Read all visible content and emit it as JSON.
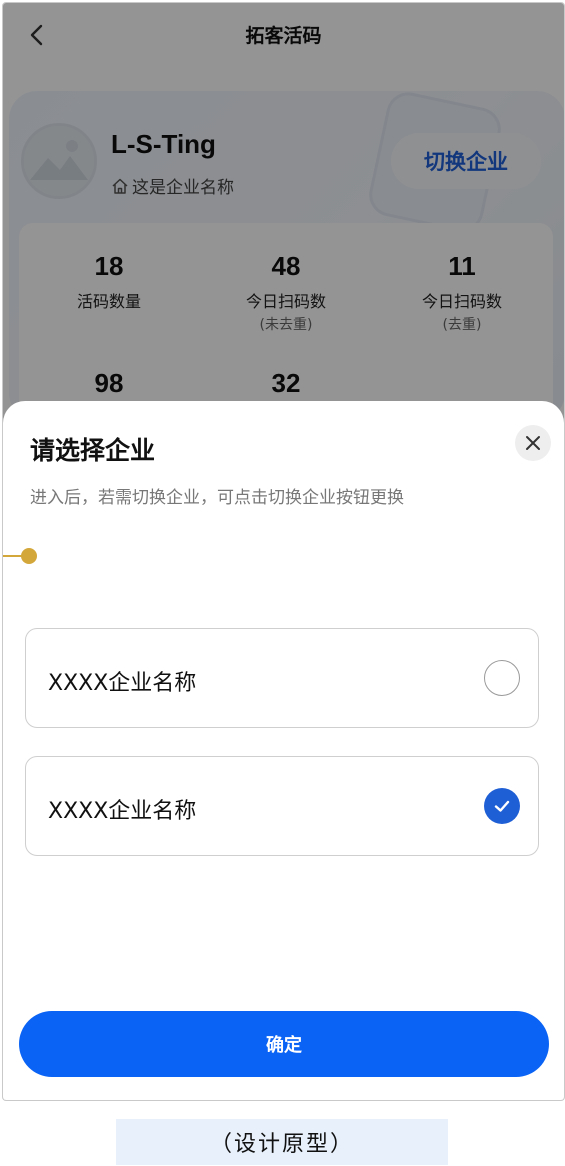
{
  "navbar": {
    "title": "拓客活码",
    "back_icon": "chevron-left-icon"
  },
  "profile": {
    "username": "L-S-Ting",
    "company_name": "这是企业名称",
    "company_icon": "home-icon",
    "switch_label": "切换企业"
  },
  "stats": [
    {
      "value": "18",
      "label": "活码数量",
      "sub": ""
    },
    {
      "value": "48",
      "label": "今日扫码数",
      "sub": "(未去重)"
    },
    {
      "value": "11",
      "label": "今日扫码数",
      "sub": "(去重)"
    },
    {
      "value": "98",
      "label": "",
      "sub": ""
    },
    {
      "value": "32",
      "label": "",
      "sub": ""
    }
  ],
  "sheet": {
    "title": "请选择企业",
    "hint": "进入后，若需切换企业，可点击切换企业按钮更换",
    "close_icon": "close-icon",
    "options": [
      {
        "label": "XXXX企业名称",
        "selected": false
      },
      {
        "label": "XXXX企业名称",
        "selected": true
      }
    ],
    "confirm_label": "确定"
  },
  "caption": "（设计原型）",
  "colors": {
    "accent": "#0a63f5",
    "selected_radio": "#1f5fd6",
    "overlay": "rgba(0,0,0,0.42)",
    "pin": "#d4a73a"
  }
}
